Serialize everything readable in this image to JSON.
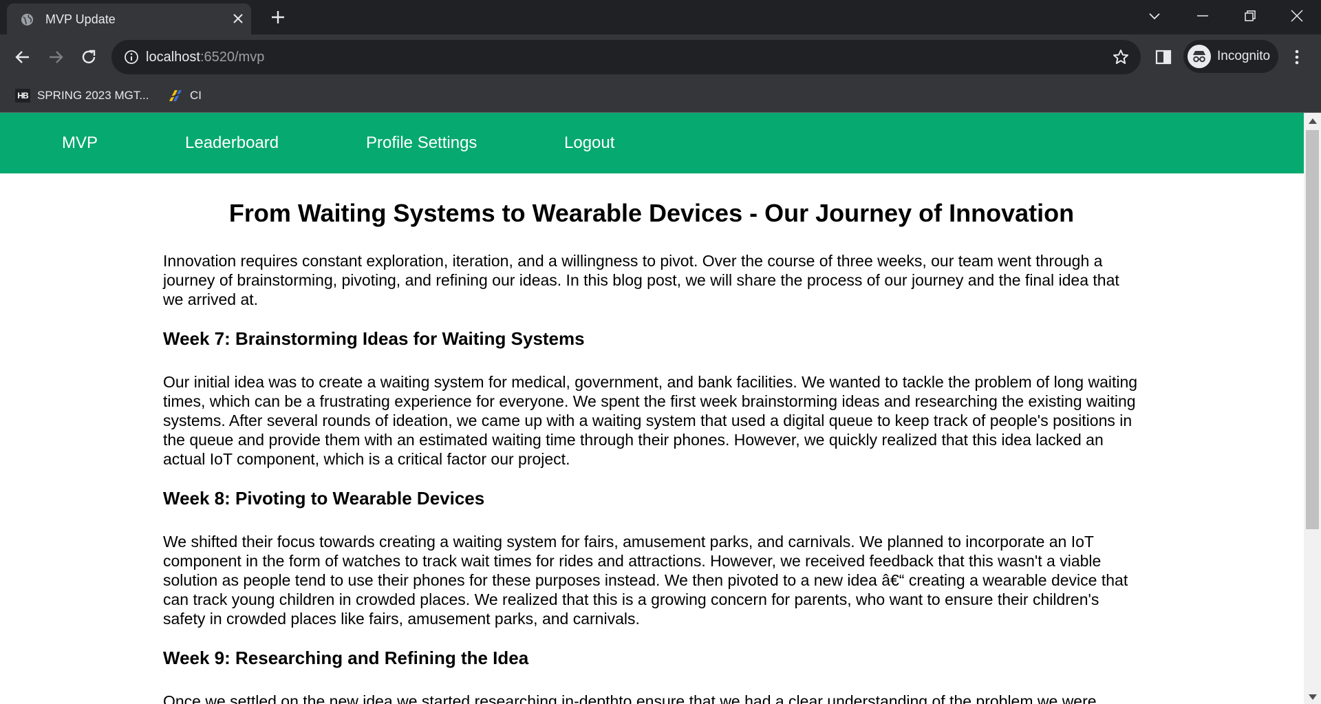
{
  "browser": {
    "tab_title": "MVP Update",
    "url_host": "localhost",
    "url_rest": ":6520/mvp",
    "profile_label": "Incognito",
    "bookmarks": [
      {
        "label": "SPRING 2023 MGT...",
        "icon": "hb-icon",
        "icon_text": "HB"
      },
      {
        "label": "CI",
        "icon": "ci-icon"
      }
    ]
  },
  "nav": {
    "items": [
      {
        "label": "MVP"
      },
      {
        "label": "Leaderboard"
      },
      {
        "label": "Profile Settings"
      },
      {
        "label": "Logout"
      }
    ],
    "color": "#06a96f"
  },
  "article": {
    "title": "From Waiting Systems to Wearable Devices - Our Journey of Innovation",
    "intro": "Innovation requires constant exploration, iteration, and a willingness to pivot. Over the course of three weeks, our team went through a journey of brainstorming, pivoting, and refining our ideas. In this blog post, we will share the process of our journey and the final idea that we arrived at.",
    "sections": [
      {
        "heading": "Week 7: Brainstorming Ideas for Waiting Systems",
        "body": "Our initial idea was to create a waiting system for medical, government, and bank facilities. We wanted to tackle the problem of long waiting times, which can be a frustrating experience for everyone. We spent the first week brainstorming ideas and researching the existing waiting systems. After several rounds of ideation, we came up with a waiting system that used a digital queue to keep track of people's positions in the queue and provide them with an estimated waiting time through their phones. However, we quickly realized that this idea lacked an actual IoT component, which is a critical factor our project."
      },
      {
        "heading": "Week 8: Pivoting to Wearable Devices",
        "body": "We shifted their focus towards creating a waiting system for fairs, amusement parks, and carnivals. We planned to incorporate an IoT component in the form of watches to track wait times for rides and attractions. However, we received feedback that this wasn't a viable solution as people tend to use their phones for these purposes instead. We then pivoted to a new idea â€“ creating a wearable device that can track young children in crowded places. We realized that this is a growing concern for parents, who want to ensure their children's safety in crowded places like fairs, amusement parks, and carnivals."
      },
      {
        "heading": "Week 9: Researching and Refining the Idea",
        "body": "Once we settled on the new idea,we started researching in-depthto ensure that we had a clear understanding of the problem we were solving and that we had a well-defined product that could effectively solve the problem. Our research showed that young children are"
      }
    ]
  }
}
